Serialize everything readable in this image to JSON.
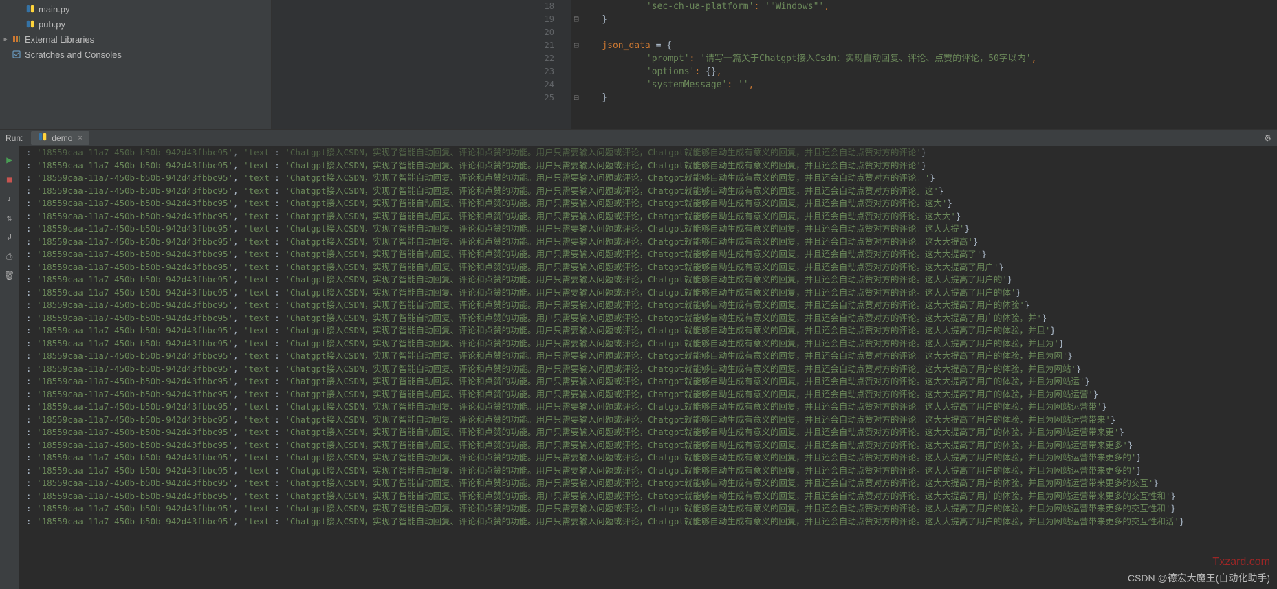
{
  "tree": {
    "main_py": "main.py",
    "pub_py": "pub.py",
    "ext_libs": "External Libraries",
    "scratches": "Scratches and Consoles"
  },
  "editor": {
    "lines": [
      {
        "n": 18,
        "indent": 3,
        "parts": [
          [
            "str",
            "'sec-ch-ua-platform'"
          ],
          [
            "punct",
            ": "
          ],
          [
            "str",
            "'\"Windows\"'"
          ],
          [
            "punct",
            ","
          ]
        ]
      },
      {
        "n": 19,
        "indent": 1,
        "fold": "close",
        "parts": [
          [
            "brace",
            "}"
          ]
        ]
      },
      {
        "n": 20,
        "indent": 0,
        "parts": []
      },
      {
        "n": 21,
        "indent": 1,
        "fold": "open",
        "parts": [
          [
            "key",
            "json_data "
          ],
          [
            "eq",
            "= "
          ],
          [
            "brace",
            "{"
          ]
        ]
      },
      {
        "n": 22,
        "indent": 3,
        "parts": [
          [
            "str",
            "'prompt'"
          ],
          [
            "punct",
            ": "
          ],
          [
            "str",
            "'请写一篇关于Chatgpt接入Csdn：实现自动回复、评论、点赞的评论，50字以内'"
          ],
          [
            "punct",
            ","
          ]
        ]
      },
      {
        "n": 23,
        "indent": 3,
        "parts": [
          [
            "str",
            "'options'"
          ],
          [
            "punct",
            ": "
          ],
          [
            "brace",
            "{}"
          ],
          [
            "punct",
            ","
          ]
        ]
      },
      {
        "n": 24,
        "indent": 3,
        "parts": [
          [
            "str",
            "'systemMessage'"
          ],
          [
            "punct",
            ": "
          ],
          [
            "str",
            "''"
          ],
          [
            "punct",
            ","
          ]
        ]
      },
      {
        "n": 25,
        "indent": 1,
        "fold": "close",
        "parts": [
          [
            "brace",
            "}"
          ]
        ]
      }
    ]
  },
  "run": {
    "label": "Run:",
    "tab": "demo",
    "id": "18559caa-11a7-450b-b50b-942d43fbbc95",
    "textKey": "text",
    "base": "Chatgpt接入CSDN，实现了智能自动回复、评论和点赞的功能。用户只需要输入问题或评论，Chatgpt就能够自动生成有意义的回复，并且还会自动点赞对方的评论",
    "suffixes": [
      "",
      "。",
      "。这",
      "。这大",
      "。这大大",
      "。这大大提",
      "。这大大提高",
      "。这大大提高了",
      "。这大大提高了用户",
      "。这大大提高了用户的",
      "。这大大提高了用户的体",
      "。这大大提高了用户的体验",
      "。这大大提高了用户的体验，并",
      "。这大大提高了用户的体验，并且",
      "。这大大提高了用户的体验，并且为",
      "。这大大提高了用户的体验，并且为网",
      "。这大大提高了用户的体验，并且为网站",
      "。这大大提高了用户的体验，并且为网站运",
      "。这大大提高了用户的体验，并且为网站运营",
      "。这大大提高了用户的体验，并且为网站运营带",
      "。这大大提高了用户的体验，并且为网站运营带来",
      "。这大大提高了用户的体验，并且为网站运营带来更",
      "。这大大提高了用户的体验，并且为网站运营带来更多",
      "。这大大提高了用户的体验，并且为网站运营带来更多的",
      "。这大大提高了用户的体验，并且为网站运营带来更多的",
      "。这大大提高了用户的体验，并且为网站运营带来更多的交互",
      "。这大大提高了用户的体验，并且为网站运营带来更多的交互性和",
      "。这大大提高了用户的体验，并且为网站运营带来更多的交互性和",
      "。这大大提高了用户的体验，并且为网站运营带来更多的交互性和活"
    ]
  },
  "footer": "CSDN @德宏大魔王(自动化助手)",
  "watermark": "Txzard.com"
}
